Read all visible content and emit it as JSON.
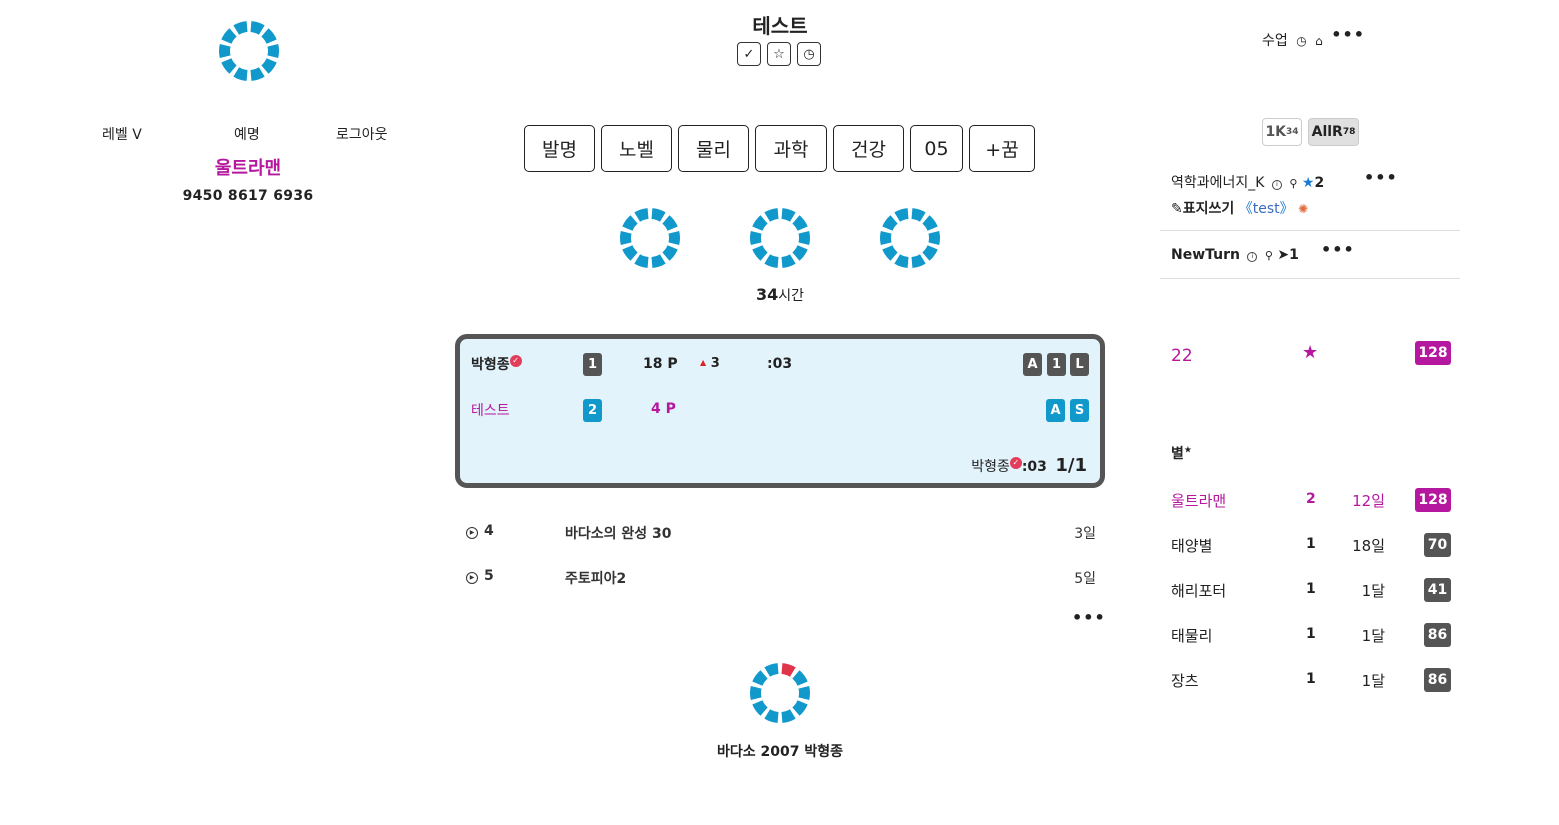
{
  "user": {
    "links": [
      "레벨 V",
      "예명",
      "로그아웃"
    ],
    "name": "울트라맨",
    "phone": "9450 8617 6936"
  },
  "header": {
    "title": "테스트",
    "icon_buttons": [
      "check-icon",
      "star-icon",
      "clock-icon"
    ]
  },
  "top_right": {
    "label": "수업",
    "icons": [
      "clock-icon",
      "home-icon",
      "more-icon"
    ],
    "more": "•••"
  },
  "categories": [
    "발명",
    "노벨",
    "물리",
    "과학",
    "건강",
    "05",
    "+꿈"
  ],
  "summary": {
    "hours_value": "34",
    "hours_unit": "시간"
  },
  "game": {
    "player1": {
      "name": "박형종",
      "badge": "1",
      "points": "18 P",
      "delta": "3",
      "time": ":03",
      "tags": [
        "A",
        "1",
        "L"
      ]
    },
    "player2": {
      "name": "테스트",
      "badge": "2",
      "points": "4 P",
      "tags": [
        "A",
        "S"
      ]
    },
    "footer": {
      "name": "박형종",
      "time": ":03",
      "turn": "1/1"
    },
    "colors": {
      "accent": "#b5179e",
      "blue": "#1199cc",
      "dark": "#555555"
    }
  },
  "history": [
    {
      "num": "4",
      "title": "바다소의 완성 30",
      "ago": "3일"
    },
    {
      "num": "5",
      "title": "주토피아2",
      "ago": "5일"
    }
  ],
  "history_more": "•••",
  "footer_caption": "바다소 2007 박형종",
  "right": {
    "tabs": [
      {
        "label": "1K",
        "sup": "34"
      },
      {
        "label": "AllR",
        "sup": "78"
      }
    ],
    "groups": [
      {
        "name": "역학과에너지_K",
        "stars": "2",
        "edit_label": "표지쓰기",
        "tag": "test"
      },
      {
        "name": "NewTurn",
        "sends": "1"
      }
    ],
    "more": "•••",
    "stats": {
      "left": "22",
      "right": "128"
    },
    "star_label": "별",
    "rankings": [
      {
        "name": "울트라맨",
        "count": "2",
        "period": "12일",
        "score": "128",
        "highlight": true
      },
      {
        "name": "태양별",
        "count": "1",
        "period": "18일",
        "score": "70"
      },
      {
        "name": "해리포터",
        "count": "1",
        "period": "1달",
        "score": "41"
      },
      {
        "name": "태물리",
        "count": "1",
        "period": "1달",
        "score": "86"
      },
      {
        "name": "장츠",
        "count": "1",
        "period": "1달",
        "score": "86"
      }
    ]
  }
}
